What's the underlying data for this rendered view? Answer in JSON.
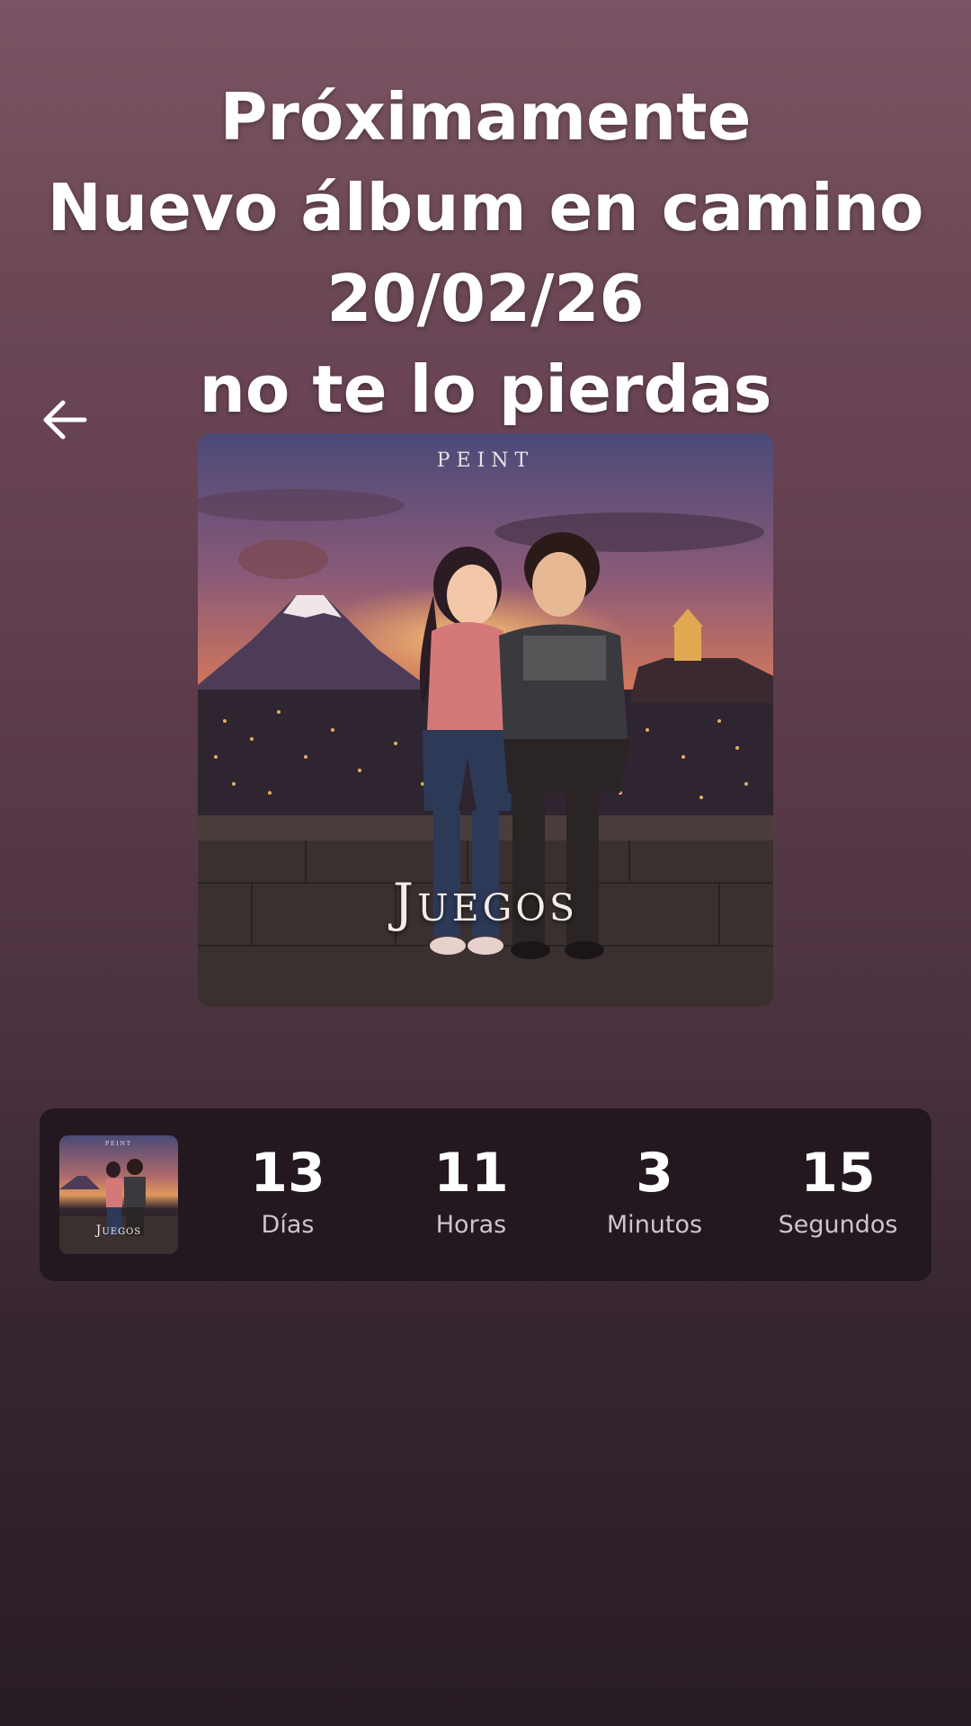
{
  "caption": {
    "lines": [
      "Próximamente",
      "Nuevo álbum en camino",
      "20/02/26",
      "no te lo pierdas"
    ]
  },
  "navigation": {
    "back_icon": "arrow-left-icon"
  },
  "album": {
    "artist": "PEINT",
    "title": "Juegos"
  },
  "countdown": {
    "days": {
      "value": "13",
      "label": "Días"
    },
    "hours": {
      "value": "11",
      "label": "Horas"
    },
    "minutes": {
      "value": "3",
      "label": "Minutos"
    },
    "seconds": {
      "value": "15",
      "label": "Segundos"
    }
  }
}
